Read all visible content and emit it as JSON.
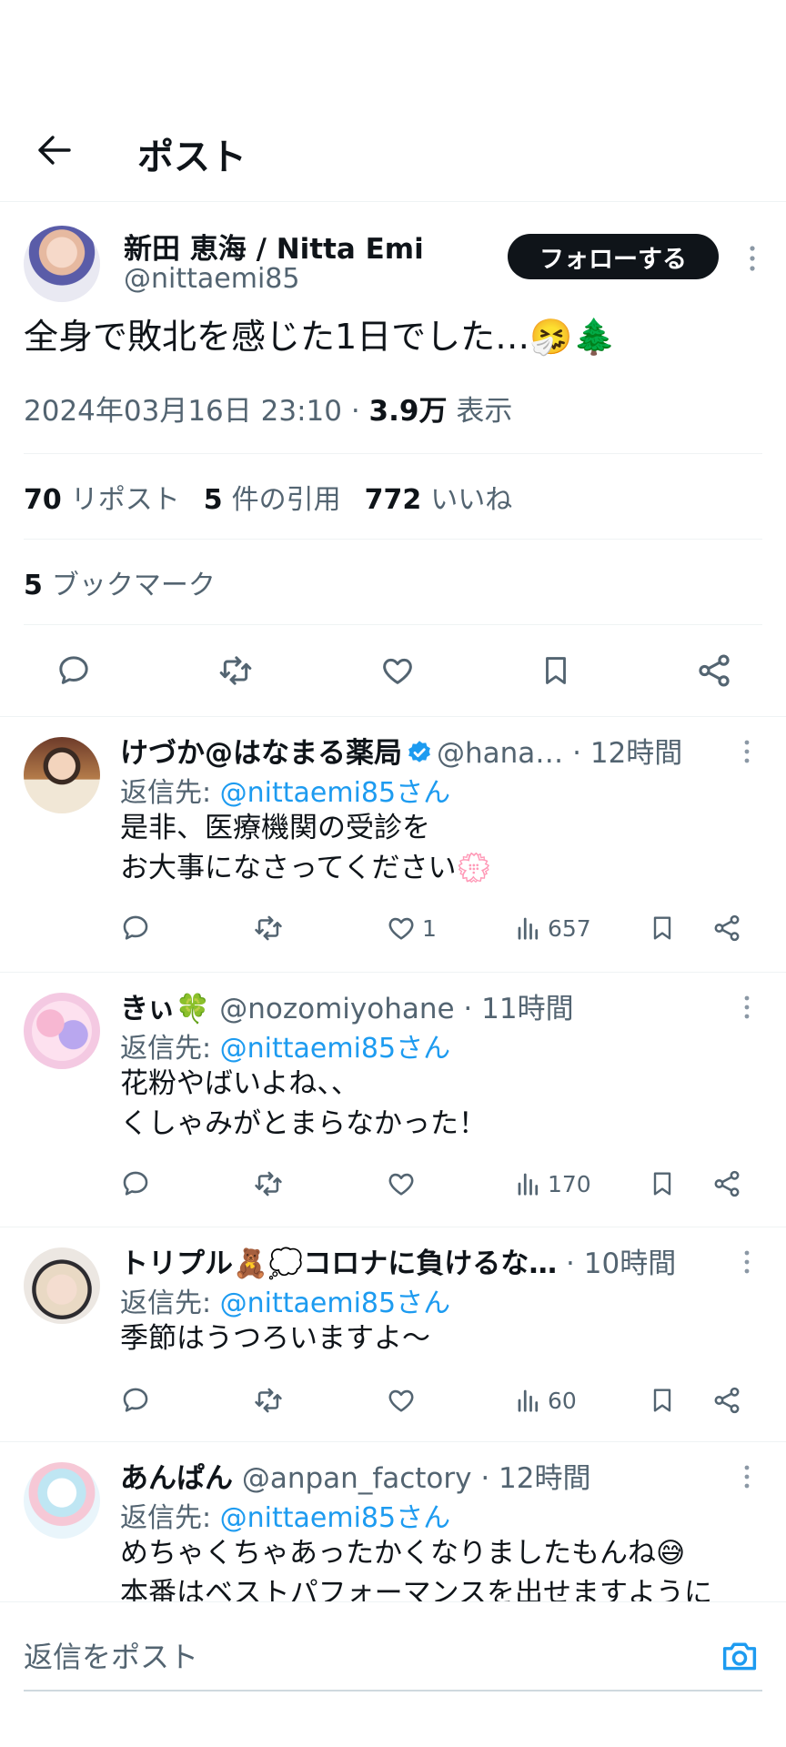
{
  "header": {
    "title": "ポスト"
  },
  "post": {
    "author_name": "新田 恵海 / Nitta Emi",
    "author_handle": "@nittaemi85",
    "follow_label": "フォローする",
    "text": "全身で敗北を感じた1日でした…🤧🌲",
    "timestamp": "2024年03月16日 23:10",
    "sep": " · ",
    "views_count": "3.9万",
    "views_label": " 表示",
    "stats": {
      "reposts_count": "70",
      "reposts_label": "リポスト",
      "quotes_count": "5",
      "quotes_label": "件の引用",
      "likes_count": "772",
      "likes_label": "いいね",
      "bookmarks_count": "5",
      "bookmarks_label": "ブックマーク"
    }
  },
  "replies": [
    {
      "name": "けづか@はなまる薬局",
      "verified": true,
      "handle": "@hana…",
      "time": " · 12時間",
      "reply_to_prefix": "返信先: ",
      "reply_to": "@nittaemi85さん",
      "lines": [
        "是非、医療機関の受診を",
        "お大事になさってください💮"
      ],
      "likes": "1",
      "views": "657"
    },
    {
      "name": "きぃ🍀",
      "verified": false,
      "handle": "@nozomiyohane",
      "time": " · 11時間",
      "reply_to_prefix": "返信先: ",
      "reply_to": "@nittaemi85さん",
      "lines": [
        "花粉やばいよね、、",
        "くしゃみがとまらなかった！"
      ],
      "likes": "",
      "views": "170"
    },
    {
      "name": "トリプル🧸💭コロナに負けるな…",
      "verified": false,
      "handle": "",
      "time": " · 10時間",
      "reply_to_prefix": "返信先: ",
      "reply_to": "@nittaemi85さん",
      "lines": [
        "季節はうつろいますよ〜"
      ],
      "likes": "",
      "views": "60"
    },
    {
      "name": "あんぱん",
      "verified": false,
      "handle": "@anpan_factory",
      "time": " · 12時間",
      "reply_to_prefix": "返信先: ",
      "reply_to": "@nittaemi85さん",
      "lines": [
        "めちゃくちゃあったかくなりましたもんね😅",
        "本番はベストパフォーマンスを出せますように"
      ],
      "likes": "",
      "views": ""
    }
  ],
  "composer": {
    "placeholder": "返信をポスト"
  },
  "colors": {
    "accent": "#1d9bf0",
    "text": "#0f1419",
    "muted": "#536471",
    "divider": "#eff3f4"
  },
  "icons": [
    "back-arrow-icon",
    "more-icon",
    "reply-icon",
    "repost-icon",
    "like-icon",
    "bookmark-icon",
    "share-icon",
    "views-icon",
    "verified-icon",
    "camera-icon"
  ]
}
